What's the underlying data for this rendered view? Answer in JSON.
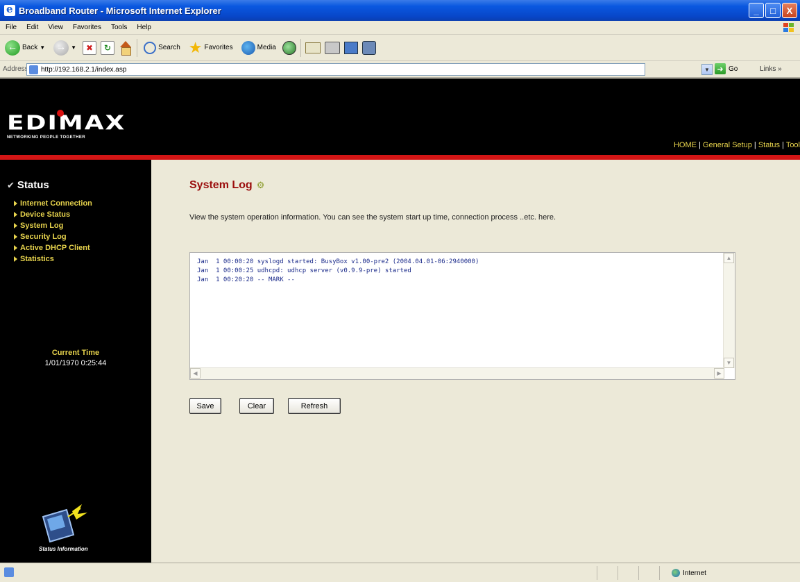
{
  "window": {
    "title": "Broadband Router - Microsoft Internet Explorer",
    "controls": [
      "_",
      "□",
      "X"
    ]
  },
  "menu": [
    "File",
    "Edit",
    "View",
    "Favorites",
    "Tools",
    "Help"
  ],
  "toolbar": {
    "back": "Back",
    "search": "Search",
    "favorites": "Favorites",
    "media": "Media"
  },
  "address": {
    "label": "Address",
    "url": "http://192.168.2.1/index.asp",
    "go": "Go",
    "links": "Links",
    "links_chevron": "»"
  },
  "header": {
    "logo": "EDIMAX",
    "tagline": "NETWORKING PEOPLE TOGETHER",
    "nav": [
      "HOME",
      "General Setup",
      "Status",
      "Tool"
    ]
  },
  "sidebar": {
    "title": "Status",
    "items": [
      "Internet Connection",
      "Device Status",
      "System Log",
      "Security Log",
      "Active DHCP Client",
      "Statistics"
    ],
    "current_time_label": "Current Time",
    "current_time_value": "1/01/1970 0:25:44",
    "status_caption": "Status Information"
  },
  "main": {
    "title": "System Log",
    "description": "View the system operation information. You can see the system start up time, connection process ..etc. here.",
    "log_lines": [
      "Jan  1 00:00:20 syslogd started: BusyBox v1.00-pre2 (2004.04.01-06:2940000)",
      "Jan  1 00:00:25 udhcpd: udhcp server (v0.9.9-pre) started",
      "Jan  1 00:20:20 -- MARK --"
    ],
    "buttons": {
      "save": "Save",
      "clear": "Clear",
      "refresh": "Refresh"
    }
  },
  "statusbar": {
    "zone": "Internet"
  },
  "colors": {
    "title_bar": "#0A58E0",
    "header_bg": "#000000",
    "accent_red": "#D21515",
    "nav_yellow": "#E8D44D",
    "page_title": "#9B0D0D",
    "log_text": "#1A2A8A"
  }
}
